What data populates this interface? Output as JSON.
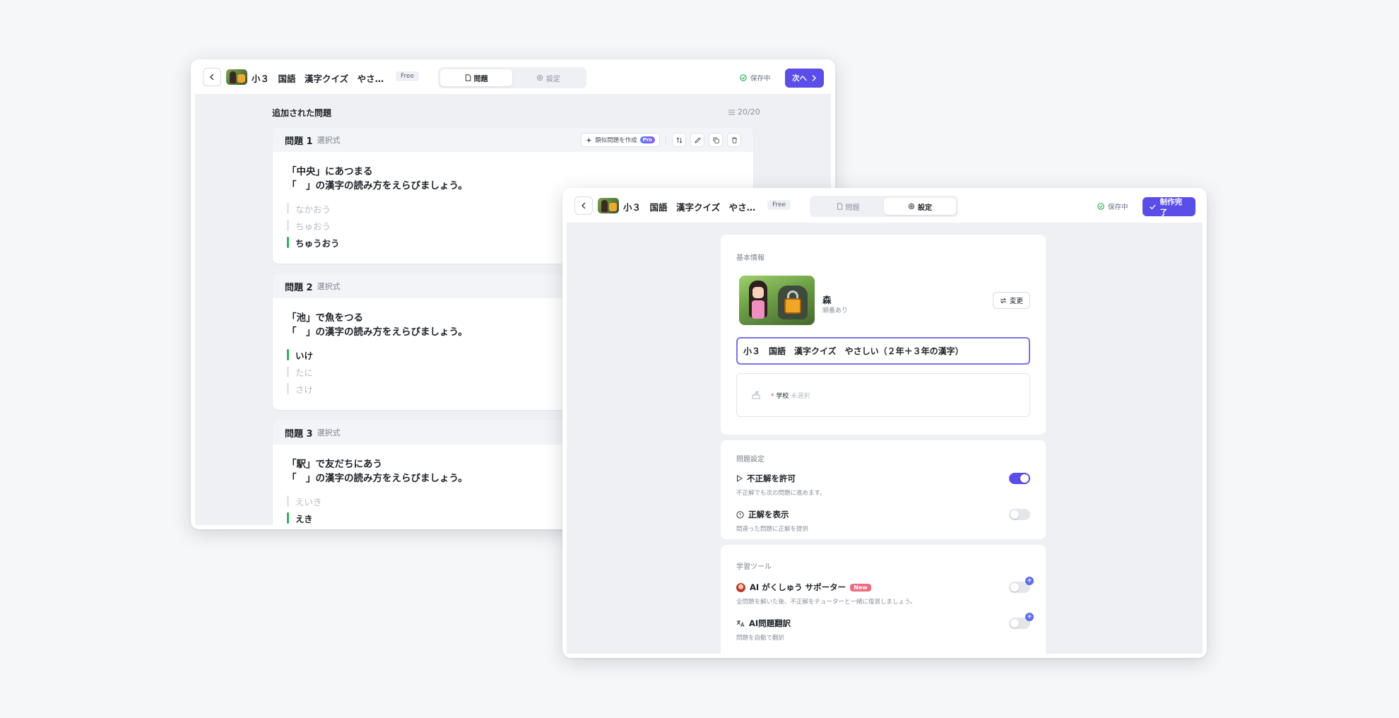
{
  "window1": {
    "title": "小３　国語　漢字クイズ　やさしい…",
    "free_badge": "Free",
    "tabs": [
      {
        "label": "問題",
        "icon": "document-icon"
      },
      {
        "label": "設定",
        "icon": "gear-icon"
      }
    ],
    "active_tab": 0,
    "saving": "保存中",
    "next_button": "次へ",
    "section_title": "追加された問題",
    "count": "20/20",
    "similar_button": "類似問題を作成",
    "pro_badge": "Pro",
    "questions": [
      {
        "number": "問題 1",
        "type": "選択式",
        "line1": "「中央」にあつまる",
        "line2": "「　」の漢字の読み方をえらびましょう。",
        "options": [
          {
            "text": "なかおう",
            "correct": false
          },
          {
            "text": "ちゅおう",
            "correct": false
          },
          {
            "text": "ちゅうおう",
            "correct": true
          }
        ]
      },
      {
        "number": "問題 2",
        "type": "選択式",
        "line1": "「池」で魚をつる",
        "line2": "「　」の漢字の読み方をえらびましょう。",
        "options": [
          {
            "text": "いけ",
            "correct": true
          },
          {
            "text": "たに",
            "correct": false
          },
          {
            "text": "さけ",
            "correct": false
          }
        ]
      },
      {
        "number": "問題 3",
        "type": "選択式",
        "line1": "「駅」で友だちにあう",
        "line2": "「　」の漢字の読み方をえらびましょう。",
        "options": [
          {
            "text": "えいき",
            "correct": false
          },
          {
            "text": "えき",
            "correct": true
          }
        ]
      }
    ]
  },
  "window2": {
    "title": "小３　国語　漢字クイズ　やさしい…",
    "free_badge": "Free",
    "tabs": [
      {
        "label": "問題",
        "icon": "document-icon"
      },
      {
        "label": "設定",
        "icon": "gear-icon"
      }
    ],
    "active_tab": 1,
    "saving": "保存中",
    "done_button": "制作完了",
    "basic_info": {
      "label": "基本情報",
      "background_name": "森",
      "background_sub": "順番あり",
      "change_button": "変更",
      "title_value": "小３　国語　漢字クイズ　やさしい（２年＋３年の漢字）",
      "school_required_mark": "*",
      "school_label": "学校",
      "school_value": "未選択"
    },
    "question_settings": {
      "label": "問題設定",
      "items": [
        {
          "title": "不正解を許可",
          "desc": "不正解でも次の問題に進めます。",
          "on": true,
          "icon": "play-icon"
        },
        {
          "title": "正解を表示",
          "desc": "間違った問題に正解を提供",
          "on": false,
          "icon": "info-icon"
        }
      ]
    },
    "learning_tools": {
      "label": "学習ツール",
      "items": [
        {
          "title": "AI がくしゅう サポーター",
          "badge": "New",
          "desc": "全問題を解いた後、不正解をチューターと一緒に復習しましょう。",
          "on": false,
          "icon": "tutor-avatar-icon"
        },
        {
          "title": "AI問題翻訳",
          "desc": "問題を自動で翻訳",
          "on": false,
          "icon": "translate-icon"
        }
      ]
    }
  },
  "colors": {
    "primary": "#5b4ee8",
    "correct": "#2fb15c",
    "saved": "#2fb15c",
    "new_badge": "#f06b7d"
  }
}
